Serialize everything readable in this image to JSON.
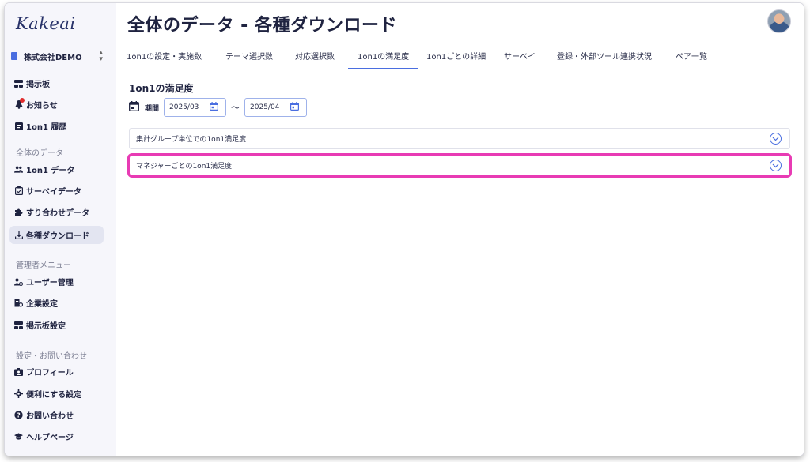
{
  "app": {
    "logo": "Kakeai"
  },
  "company": {
    "name": "株式会社DEMO",
    "switch": "⌃⌄"
  },
  "sidebar": {
    "items": [
      {
        "label": "掲示板",
        "icon": "board-icon"
      },
      {
        "label": "お知らせ",
        "icon": "bell-icon",
        "badge": true
      },
      {
        "label": "1on1 履歴",
        "icon": "history-icon"
      }
    ],
    "sections": [
      {
        "title": "全体のデータ",
        "items": [
          {
            "label": "1on1 データ",
            "icon": "people-icon"
          },
          {
            "label": "サーベイデータ",
            "icon": "survey-icon"
          },
          {
            "label": "すり合わせデータ",
            "icon": "puzzle-icon"
          },
          {
            "label": "各種ダウンロード",
            "icon": "download-icon",
            "active": true
          }
        ]
      },
      {
        "title": "管理者メニュー",
        "items": [
          {
            "label": "ユーザー管理",
            "icon": "user-manage-icon"
          },
          {
            "label": "企業設定",
            "icon": "company-settings-icon"
          },
          {
            "label": "掲示板設定",
            "icon": "board-settings-icon"
          }
        ]
      },
      {
        "title": "設定・お問い合わせ",
        "items": [
          {
            "label": "プロフィール",
            "icon": "profile-icon"
          },
          {
            "label": "便利にする設定",
            "icon": "gear-icon"
          },
          {
            "label": "お問い合わせ",
            "icon": "help-icon"
          },
          {
            "label": "ヘルプページ",
            "icon": "graduation-icon"
          }
        ]
      }
    ]
  },
  "header": {
    "title": "全体のデータ - 各種ダウンロード"
  },
  "tabs": [
    {
      "label": "1on1の設定・実施数"
    },
    {
      "label": "テーマ選択数"
    },
    {
      "label": "対応選択数"
    },
    {
      "label": "1on1の満足度",
      "active": true
    },
    {
      "label": "1on1ごとの詳細"
    },
    {
      "label": "サーベイ"
    },
    {
      "label": "登録・外部ツール連携状況"
    },
    {
      "label": "ペア一覧"
    }
  ],
  "content": {
    "title": "1on1の満足度",
    "period_label": "期間",
    "from": "2025/03",
    "separator": "〜",
    "to": "2025/04",
    "accordions": [
      {
        "label": "集計グループ単位での1on1満足度",
        "highlighted": false
      },
      {
        "label": "マネジャーごとの1on1満足度",
        "highlighted": true
      }
    ]
  },
  "colors": {
    "accent": "#4a6ee0",
    "highlight": "#e83bb4",
    "sidebar_bg": "#f6f6fb"
  }
}
